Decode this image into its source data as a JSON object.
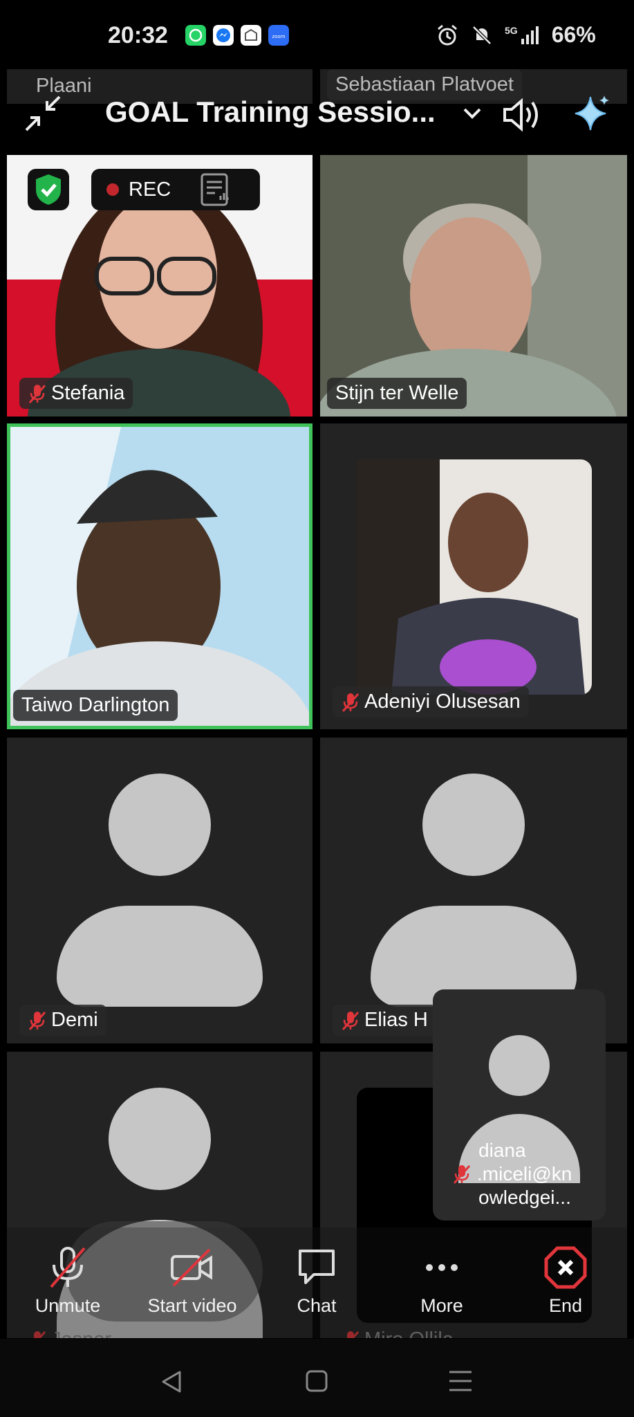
{
  "status_bar": {
    "time": "20:32",
    "network": "5G",
    "battery": "66%",
    "app_icons": [
      "whatsapp-icon",
      "messenger-icon",
      "mail-icon",
      "zoom-icon"
    ]
  },
  "meeting": {
    "title": "GOAL Training Sessio...",
    "recording_label": "REC"
  },
  "top_row_names": [
    "Plaani",
    "Sebastiaan Platvoet"
  ],
  "participants": [
    {
      "name": "Stefania",
      "muted": true
    },
    {
      "name": "Stijn ter Welle",
      "muted": false
    },
    {
      "name": "Taiwo Darlington",
      "muted": false,
      "active_speaker": true
    },
    {
      "name": "Adeniyi Olusesan",
      "muted": true
    },
    {
      "name": "Demi",
      "muted": true
    },
    {
      "name": "Elias  H",
      "muted": true
    },
    {
      "name": "Jasper",
      "muted": true
    },
    {
      "name": "Miro Ollila",
      "muted": true
    }
  ],
  "floating": {
    "name_line1": "diana",
    "name_line2": ".miceli@kn",
    "name_line3": "owledgei..."
  },
  "toolbar": {
    "unmute": "Unmute",
    "start_video": "Start video",
    "chat": "Chat",
    "more": "More",
    "end": "End"
  },
  "colors": {
    "active_border": "#3fc25a",
    "mic_off": "#e0353b",
    "end_red": "#e0353b",
    "tile_bg": "#232323",
    "shield_green": "#22b34a"
  }
}
